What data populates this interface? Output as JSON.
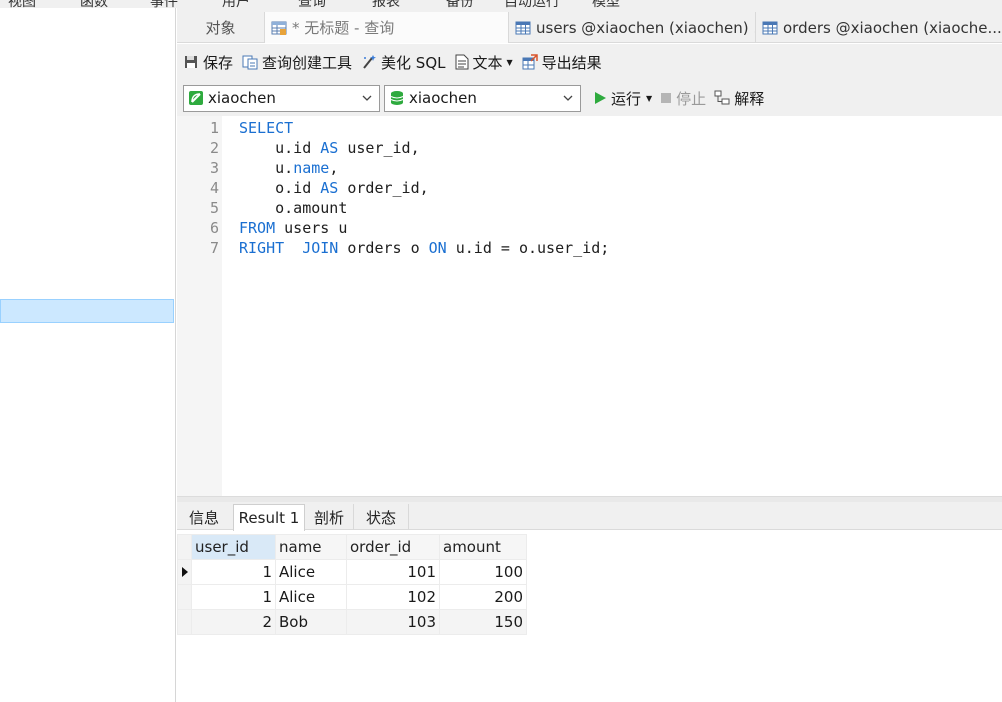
{
  "menubar": {
    "items": [
      "视图",
      "函数",
      "事件",
      "用户",
      "查询",
      "报表",
      "备份",
      "自动运行",
      "模型"
    ]
  },
  "tabs": [
    {
      "label": "对象",
      "icon": "none"
    },
    {
      "label": "* 无标题 - 查询",
      "icon": "query-grid-icon"
    },
    {
      "label": "users @xiaochen (xiaochen) ...",
      "icon": "table-icon"
    },
    {
      "label": "orders @xiaochen (xiaoche...",
      "icon": "table-icon"
    }
  ],
  "toolbar": {
    "save": "保存",
    "query_builder": "查询创建工具",
    "beautify": "美化 SQL",
    "text": "文本",
    "export": "导出结果"
  },
  "toolbar2": {
    "connection": "xiaochen",
    "database": "xiaochen",
    "run": "运行",
    "stop": "停止",
    "explain": "解释"
  },
  "editor": {
    "lines": [
      {
        "n": "1",
        "segs": [
          [
            "kw",
            "SELECT"
          ]
        ]
      },
      {
        "n": "2",
        "segs": [
          [
            "",
            "    u.id "
          ],
          [
            "kw",
            "AS"
          ],
          [
            "",
            " user_id,"
          ]
        ]
      },
      {
        "n": "3",
        "segs": [
          [
            "",
            "    u."
          ],
          [
            "kw",
            "name"
          ],
          [
            "",
            ","
          ]
        ]
      },
      {
        "n": "4",
        "segs": [
          [
            "",
            "    o.id "
          ],
          [
            "kw",
            "AS"
          ],
          [
            "",
            " order_id,"
          ]
        ]
      },
      {
        "n": "5",
        "segs": [
          [
            "",
            "    o.amount"
          ]
        ]
      },
      {
        "n": "6",
        "segs": [
          [
            "kw",
            "FROM"
          ],
          [
            "",
            " users u"
          ]
        ]
      },
      {
        "n": "7",
        "segs": [
          [
            "kw",
            "RIGHT"
          ],
          [
            "",
            "  "
          ],
          [
            "kw",
            "JOIN"
          ],
          [
            "",
            " orders o "
          ],
          [
            "kw",
            "ON"
          ],
          [
            "",
            " u.id = o.user_id;"
          ]
        ]
      }
    ]
  },
  "result_tabs": {
    "info": "信息",
    "result": "Result 1",
    "profile": "剖析",
    "status": "状态"
  },
  "grid": {
    "columns": [
      "user_id",
      "name",
      "order_id",
      "amount"
    ],
    "rows": [
      [
        "1",
        "Alice",
        "101",
        "100"
      ],
      [
        "1",
        "Alice",
        "102",
        "200"
      ],
      [
        "2",
        "Bob",
        "103",
        "150"
      ]
    ]
  },
  "colors": {
    "keyword": "#1a6fd1",
    "selection": "#cce8ff",
    "run_green": "#2eaa3e"
  }
}
